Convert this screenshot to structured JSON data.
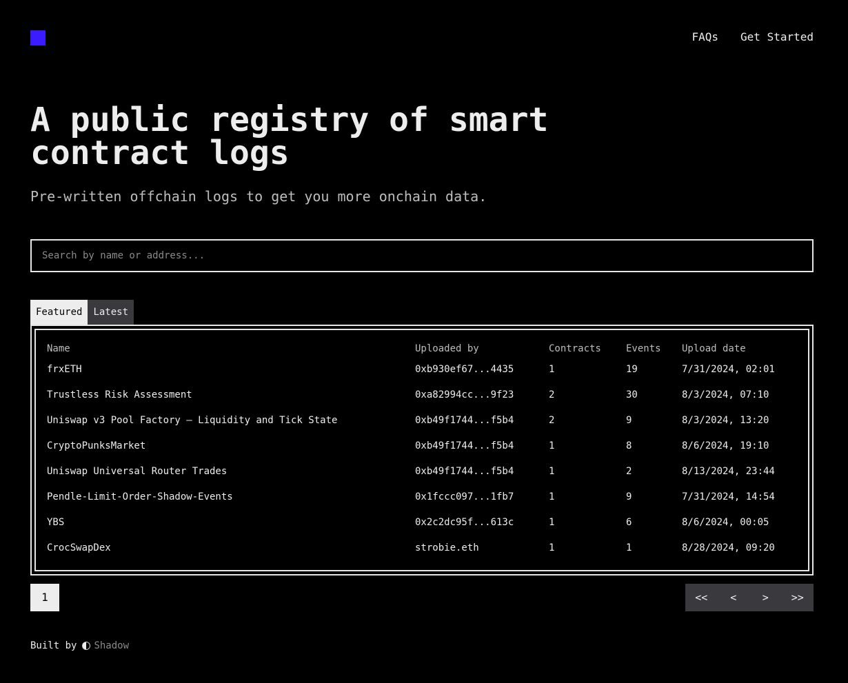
{
  "brand": {
    "logo_color": "#3b1cff"
  },
  "nav": {
    "items": [
      {
        "label": "FAQs"
      },
      {
        "label": "Get Started"
      }
    ]
  },
  "hero": {
    "title": "A public registry of smart contract logs",
    "subtitle": "Pre-written offchain logs to get you more onchain data."
  },
  "search": {
    "placeholder": "Search by name or address...",
    "value": ""
  },
  "tabs": [
    {
      "label": "Featured",
      "active": true
    },
    {
      "label": "Latest",
      "active": false
    }
  ],
  "table": {
    "columns": [
      "Name",
      "Uploaded by",
      "Contracts",
      "Events",
      "Upload date"
    ],
    "rows": [
      [
        "frxETH",
        "0xb930ef67...4435",
        "1",
        "19",
        "7/31/2024, 02:01"
      ],
      [
        "Trustless Risk Assessment",
        "0xa82994cc...9f23",
        "2",
        "30",
        "8/3/2024, 07:10"
      ],
      [
        "Uniswap v3 Pool Factory – Liquidity and Tick State",
        "0xb49f1744...f5b4",
        "2",
        "9",
        "8/3/2024, 13:20"
      ],
      [
        "CryptoPunksMarket",
        "0xb49f1744...f5b4",
        "1",
        "8",
        "8/6/2024, 19:10"
      ],
      [
        "Uniswap Universal Router Trades",
        "0xb49f1744...f5b4",
        "1",
        "2",
        "8/13/2024, 23:44"
      ],
      [
        "Pendle-Limit-Order-Shadow-Events",
        "0x1fccc097...1fb7",
        "1",
        "9",
        "7/31/2024, 14:54"
      ],
      [
        "YBS",
        "0x2c2dc95f...613c",
        "1",
        "6",
        "8/6/2024, 00:05"
      ],
      [
        "CrocSwapDex",
        "strobie.eth",
        "1",
        "1",
        "8/28/2024, 09:20"
      ]
    ]
  },
  "pagination": {
    "current_page": "1",
    "first_label": "<<",
    "prev_label": "<",
    "next_label": ">",
    "last_label": ">>"
  },
  "footer": {
    "built_by": "Built by",
    "brand_icon": "half-circle-icon",
    "brand_name": "Shadow"
  }
}
